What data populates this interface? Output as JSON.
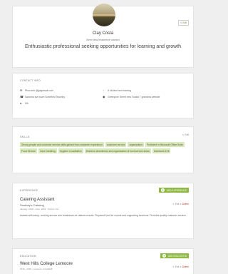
{
  "profile": {
    "name": "Clay Costa",
    "subtitle": "Been less headerline wanted",
    "headline": "Enthusiastic professional seeking opportunities for learning and growth",
    "edit_label": "✎ Edit"
  },
  "contact": {
    "section_title": "CONTACT INFO",
    "email": "Phos.info.@gagamail.com",
    "phone_left": "Saranha ave town Sorthfield Teachhy",
    "location_right": "A student and tutoring",
    "address_right": "Greenpine Street new Toadal 7 grandma website",
    "extra": "NA"
  },
  "skills": {
    "section_title": "SKILLS",
    "edit_label": "✎ Edit",
    "items": [
      "Strong people and customer service skills gained from customer experience",
      "customer service",
      "organization",
      "Proficient in Microsoft Office Suite",
      "Food Service",
      "Cash handling",
      "Hygiene & sanitation",
      "Monitors cleanliness and organization of food service areas",
      "teamwork & fit"
    ]
  },
  "experience": {
    "section_title": "EXPERIENCE",
    "add_label": "ADD EXPERIENCE",
    "title": "Catering Assistant",
    "company": "Southey's Catering",
    "meta": "January, 2019 - June, 2019 · Fresno, CA",
    "description": "Assists with setup, cooking service and breakdown at catered events. Prepared food for events and supporting functions. Provides quality customer service.",
    "edit_label": "✎ Edit",
    "delete_label": "✕ Delete"
  },
  "education": {
    "section_title": "EDUCATION",
    "add_label": "ADD EDUCATION",
    "school": "West Hills College Lemoore",
    "meta": "2015 - 2019 · Lemoore, CA 93245",
    "edit_label": "✎ Edit",
    "delete_label": "✕ Delete"
  },
  "colors": {
    "accent": "#8fb944",
    "chip_bg": "#d9e8bd",
    "background": "#efefef"
  },
  "icons": [
    "email-icon",
    "phone-icon",
    "location-icon",
    "globe-icon",
    "pin-icon",
    "plus-icon"
  ]
}
